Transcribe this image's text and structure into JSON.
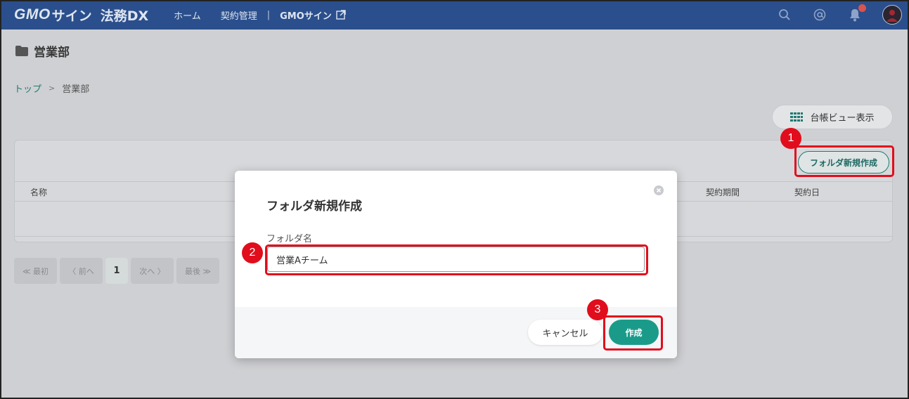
{
  "header": {
    "logo_gmo": "GMO",
    "logo_sign": "サイン",
    "logo_dx": "法務DX",
    "nav": {
      "home": "ホーム",
      "contracts": "契約管理",
      "separator": "|",
      "external": "GMOサイン"
    },
    "icons": [
      "search-icon",
      "at-icon",
      "bell-icon",
      "avatar"
    ],
    "bell_color": "#d9534f"
  },
  "page": {
    "title": "営業部",
    "breadcrumb": {
      "top": "トップ",
      "separator": ">",
      "current": "営業部"
    },
    "ledger_button": "台帳ビュー表示",
    "new_folder_button": "フォルダ新規作成",
    "columns": {
      "name": "名称",
      "period": "契約期間",
      "date": "契約日"
    },
    "pager": {
      "first": "≪ 最初",
      "prev": "〈 前へ",
      "current": "1",
      "next": "次へ 〉",
      "last": "最後 ≫"
    }
  },
  "modal": {
    "title": "フォルダ新規作成",
    "field_label": "フォルダ名",
    "field_value": "営業Aチーム",
    "cancel": "キャンセル",
    "create": "作成"
  },
  "annotations": {
    "badge1": "1",
    "badge2": "2",
    "badge3": "3",
    "color": "#e10d1c"
  },
  "colors": {
    "header_bg": "#2b4f8c",
    "accent": "#1a9b8a"
  }
}
